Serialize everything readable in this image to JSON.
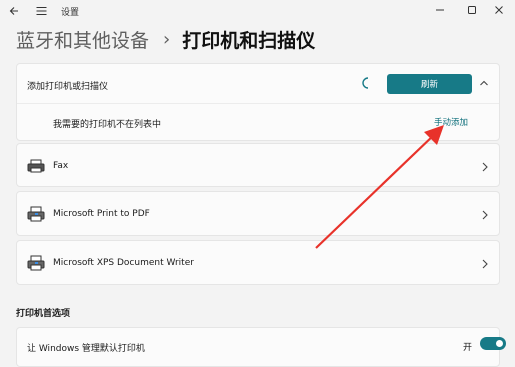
{
  "window": {
    "title": "设置",
    "back_icon": "back-arrow-icon",
    "menu_icon": "hamburger-icon",
    "controls": [
      "minimize-icon",
      "maximize-icon",
      "close-icon"
    ]
  },
  "breadcrumb": {
    "parent": "蓝牙和其他设备",
    "separator": "›",
    "current": "打印机和扫描仪"
  },
  "add_device": {
    "label": "添加打印机或扫描仪",
    "refresh_label": "刷新",
    "not_listed_text": "我需要的打印机不在列表中",
    "manual_add_label": "手动添加",
    "accent_color": "#177a87"
  },
  "printers": [
    {
      "name": "Fax"
    },
    {
      "name": "Microsoft Print to PDF"
    },
    {
      "name": "Microsoft XPS Document Writer"
    }
  ],
  "preferences": {
    "section_title": "打印机首选项",
    "default_printer_label": "让 Windows 管理默认打印机",
    "default_printer_state": "开",
    "default_printer_on": true
  },
  "annotation": {
    "arrow_color": "#e8322a"
  }
}
